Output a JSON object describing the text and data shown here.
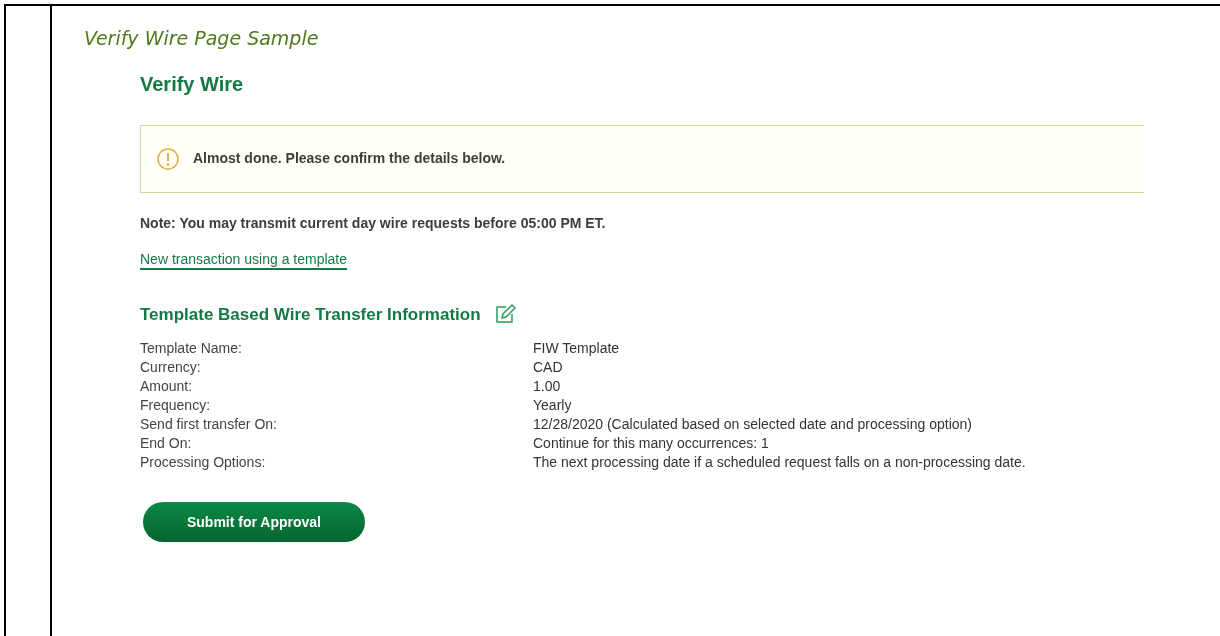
{
  "caption": "Verify Wire Page Sample",
  "heading": "Verify Wire",
  "alert": {
    "kind": "warning",
    "message": "Almost done. Please confirm the details below."
  },
  "note": "Note: You may transmit current day wire requests before 05:00 PM ET.",
  "link": "New transaction using a template",
  "section": {
    "title": "Template Based Wire Transfer Information",
    "rows": [
      {
        "label": "Template Name:",
        "value": "FIW Template"
      },
      {
        "label": "Currency:",
        "value": "CAD"
      },
      {
        "label": "Amount:",
        "value": "1.00"
      },
      {
        "label": "Frequency:",
        "value": "Yearly"
      },
      {
        "label": "Send first transfer On:",
        "value": "12/28/2020 (Calculated based on selected date and processing option)"
      },
      {
        "label": "End On:",
        "value": "Continue for this many occurrences: 1"
      },
      {
        "label": "Processing Options:",
        "value": "The next processing date if a scheduled request falls on a non-processing date."
      }
    ]
  },
  "button": "Submit for Approval"
}
